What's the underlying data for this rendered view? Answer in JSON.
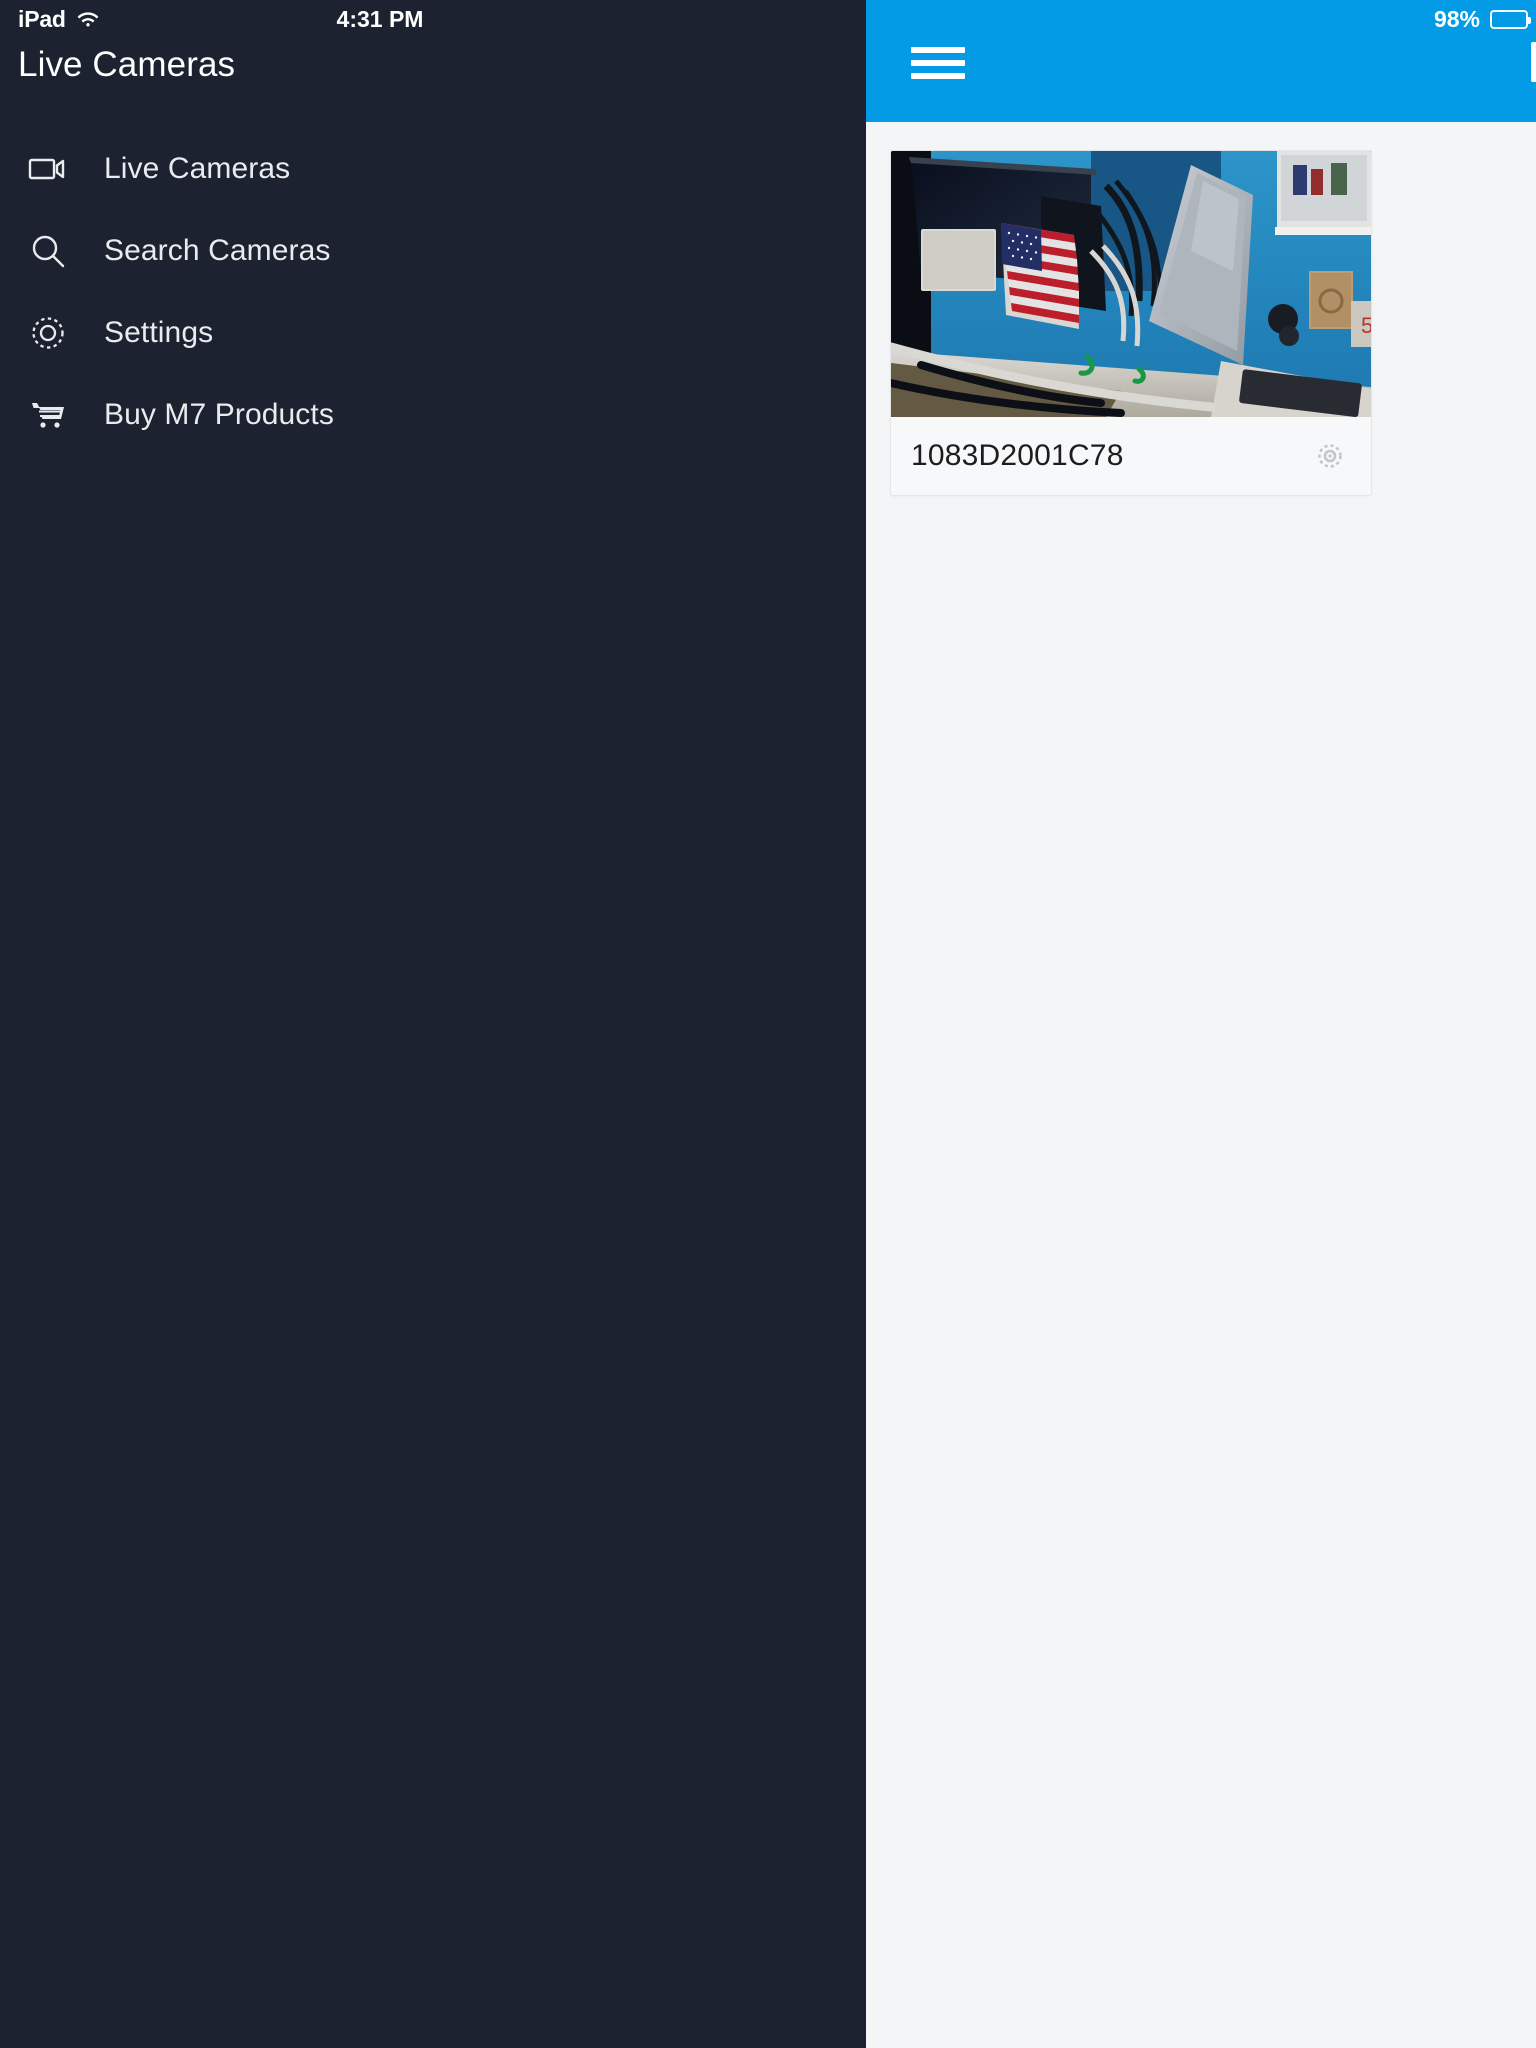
{
  "status_bar": {
    "device_label": "iPad",
    "wifi_icon": "wifi-icon",
    "time": "4:31 PM",
    "battery_percent": "98%",
    "battery_icon": "battery-full-icon"
  },
  "sidebar": {
    "title": "Live Cameras",
    "background": "#1c2230",
    "items": [
      {
        "label": "Live Cameras",
        "icon": "video-camera-icon",
        "name": "live-cameras"
      },
      {
        "label": "Search Cameras",
        "icon": "search-icon",
        "name": "search-cameras"
      },
      {
        "label": "Settings",
        "icon": "gear-icon",
        "name": "settings"
      },
      {
        "label": "Buy M7 Products",
        "icon": "shopping-cart-icon",
        "name": "buy-m7-products"
      }
    ]
  },
  "navbar": {
    "accent_color": "#039be5",
    "menu_icon": "hamburger-menu-icon"
  },
  "main": {
    "background": "#f4f5f7",
    "cameras": [
      {
        "name": "1083D2001C78",
        "settings_icon": "gear-icon",
        "thumbnail_alt": "office-desk-live-feed"
      }
    ]
  }
}
